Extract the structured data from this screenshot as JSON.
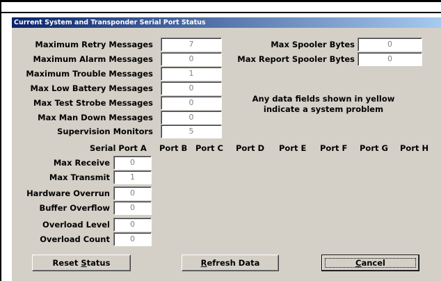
{
  "window": {
    "title": "Current System and Transponder Serial Port Status"
  },
  "system_fields": [
    {
      "label": "Maximum Retry Messages",
      "value": "7"
    },
    {
      "label": "Maximum Alarm Messages",
      "value": "0"
    },
    {
      "label": "Maximum Trouble Messages",
      "value": "1"
    },
    {
      "label": "Max Low Battery Messages",
      "value": "0"
    },
    {
      "label": "Max Test Strobe Messages",
      "value": "0"
    },
    {
      "label": "Max Man Down Messages",
      "value": "0"
    },
    {
      "label": "Supervision Monitors",
      "value": "5"
    }
  ],
  "spooler_fields": [
    {
      "label": "Max Spooler Bytes",
      "value": "0"
    },
    {
      "label": "Max Report Spooler Bytes",
      "value": "0"
    }
  ],
  "note": {
    "line1": "Any data fields shown in yellow",
    "line2": "indicate a system problem"
  },
  "port_headers": [
    "Serial Port A",
    "Port B",
    "Port C",
    "Port D",
    "Port E",
    "Port F",
    "Port G",
    "Port H"
  ],
  "port_fields": [
    {
      "label": "Max Receive",
      "value": "0"
    },
    {
      "label": "Max Transmit",
      "value": "1"
    },
    {
      "label": "Hardware Overrun",
      "value": "0"
    },
    {
      "label": "Buffer Overflow",
      "value": "0"
    },
    {
      "label": "Overload Level",
      "value": "0"
    },
    {
      "label": "Overload Count",
      "value": "0"
    }
  ],
  "buttons": {
    "reset": {
      "pre": "Reset ",
      "mnemonic": "S",
      "post": "tatus"
    },
    "refresh": {
      "pre": "",
      "mnemonic": "R",
      "post": "efresh Data"
    },
    "cancel": {
      "pre": "",
      "mnemonic": "C",
      "post": "ancel"
    }
  }
}
